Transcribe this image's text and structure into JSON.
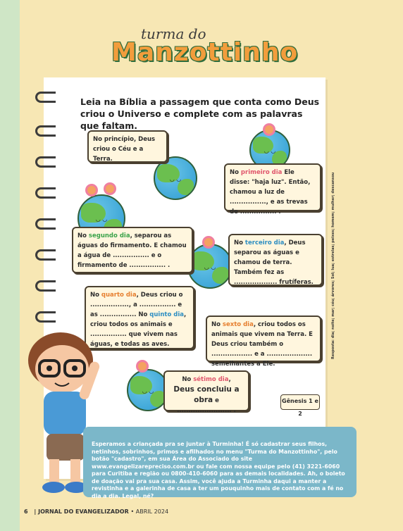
{
  "header": {
    "logo_sub": "turma do",
    "logo_main": "Manzottinho"
  },
  "instruction": "Leia na Bíblia a passagem que conta como Deus criou o Universo e complete com as palavras que faltam.",
  "boxes": {
    "b0": "No princípio, Deus criou o Céu e a Terra.",
    "b1_pre": "No ",
    "b1_day": "primeiro dia",
    "b1_post": " Ele disse: \"haja luz\". Então, chamou a luz de ................, e as trevas de ................ .",
    "b2_pre": "No ",
    "b2_day": "segundo dia",
    "b2_post": ", separou as águas do firmamento. E chamou a água de ................ e o firmamento de ................ .",
    "b3_pre": "No ",
    "b3_day": "terceiro dia",
    "b3_post": ", Deus separou as águas e chamou de terra. Também fez as ................... frutíferas.",
    "b4_pre": "No ",
    "b4_day": "quarto dia",
    "b4_mid": ", Deus criou o ................., a ................ e as ................ No ",
    "b4_day2": "quinto dia",
    "b4_post": ", criou todos os animais e ................ que vivem nas águas, e todas as aves.",
    "b5_pre": "No ",
    "b5_day": "sexto dia",
    "b5_post": ", criou todos os animais que vivem na Terra. E Deus criou também o .................. e a .................... semelhantes a Ele.",
    "b6_pre": "No ",
    "b6_day": "sétimo dia",
    "b6_post1": ",",
    "b6_post2": "Deus concluiu a obra",
    "b6_post3": " e ........................ ."
  },
  "reference": "Gênesis 1 e 2",
  "answers": "Resposta: dia; noite; mar; céu; árvores; Sol; lua; estrelas; peixes; homem; mulher; descansou",
  "message": "Esperamos a criançada pra se juntar à Turminha! É só cadastrar seus filhos, netinhos, sobrinhos, primos e afilhados no menu \"Turma do Manzottinho\", pelo botão \"cadastro\", em sua Área do Associado do site www.evangelizarepreciso.com.br ou fale com nossa equipe pelo (41) 3221-6060 para Curitiba e região ou 0800-410-6060 para as demais localidades. Ah, o boleto de doação vai pra sua casa. Assim, você ajuda a Turminha daqui a manter a revistinha e a galerinha de casa a ter um pouquinho mais de contato com a fé no dia a dia. Legal, né?",
  "footer": {
    "page": "6",
    "sep": "|",
    "publication": "JORNAL DO EVANGELIZADOR",
    "date": "• ABRIL 2024"
  },
  "colors": {
    "background": "#f7e7b4",
    "panel": "#7bb7c9",
    "accent": "#f29d3c"
  }
}
